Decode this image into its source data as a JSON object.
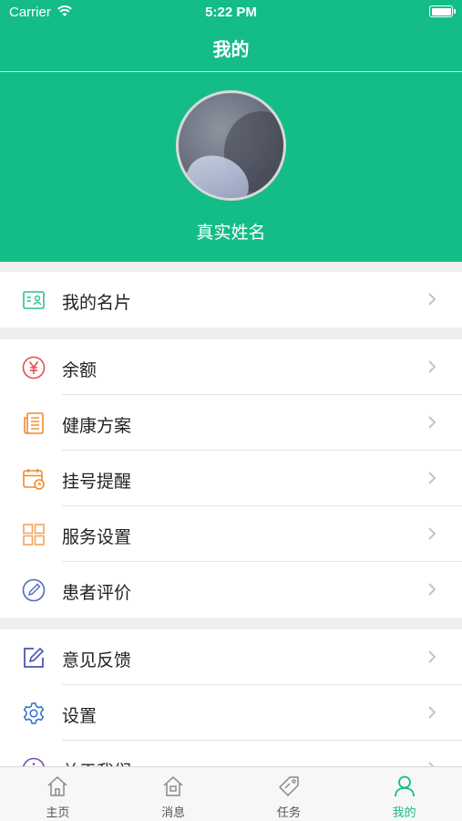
{
  "status_bar": {
    "carrier": "Carrier",
    "time": "5:22 PM"
  },
  "nav": {
    "title": "我的"
  },
  "profile": {
    "name": "真实姓名"
  },
  "menu_groups": [
    {
      "items": [
        {
          "label": "我的名片",
          "icon": "business-card-icon",
          "color": "#2fbf8f"
        }
      ]
    },
    {
      "items": [
        {
          "label": "余额",
          "icon": "yen-icon",
          "color": "#e2504c"
        },
        {
          "label": "健康方案",
          "icon": "document-icon",
          "color": "#f08a2b"
        },
        {
          "label": "挂号提醒",
          "icon": "calendar-clock-icon",
          "color": "#f08a2b"
        },
        {
          "label": "服务设置",
          "icon": "grid-icon",
          "color": "#f4a45a"
        },
        {
          "label": "患者评价",
          "icon": "pen-circle-icon",
          "color": "#5468b8"
        }
      ]
    },
    {
      "items": [
        {
          "label": "意见反馈",
          "icon": "edit-icon",
          "color": "#4a55b0"
        },
        {
          "label": "设置",
          "icon": "gear-icon",
          "color": "#2f6fc6"
        },
        {
          "label": "关于我们",
          "icon": "info-icon",
          "color": "#7a4fb0"
        }
      ]
    }
  ],
  "tabbar": {
    "tabs": [
      {
        "label": "主页",
        "icon": "home-icon",
        "active": false
      },
      {
        "label": "消息",
        "icon": "message-home-icon",
        "active": false
      },
      {
        "label": "任务",
        "icon": "tag-icon",
        "active": false
      },
      {
        "label": "我的",
        "icon": "person-icon",
        "active": true
      }
    ]
  },
  "colors": {
    "brand": "#14bd87",
    "background": "#efefef",
    "chevron": "#c4c4c4"
  }
}
